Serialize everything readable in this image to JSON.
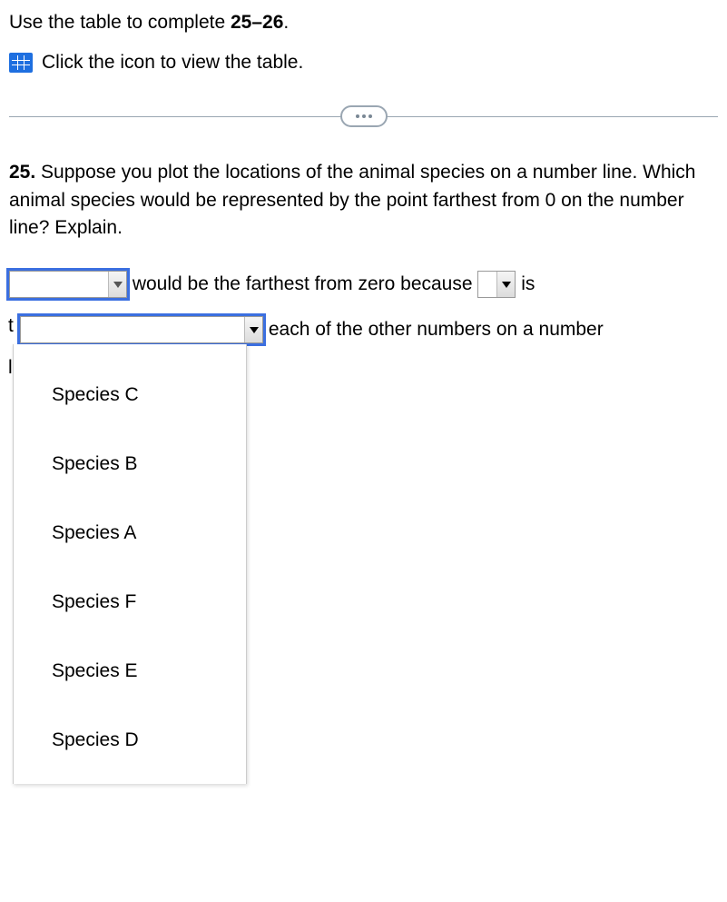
{
  "intro": {
    "prefix": "Use the table to complete ",
    "bold": "25–26",
    "suffix": "."
  },
  "icon_line": "Click the icon to view the table.",
  "question": {
    "number": "25.",
    "text": " Suppose you plot the locations of the animal species on a number line. Which animal species would be represented by the point farthest from 0 on the number line? Explain."
  },
  "answer": {
    "part1": " would be the farthest from zero because ",
    "part2_tail": " is",
    "part3_tail": " each of the other numbers on a number"
  },
  "left_chars": {
    "c1": "t",
    "c2": "l"
  },
  "dropdown1": {
    "value": "",
    "options": [
      "Species C",
      "Species B",
      "Species A",
      "Species F",
      "Species E",
      "Species D"
    ]
  },
  "dropdown2": {
    "value": ""
  },
  "dropdown3": {
    "value": ""
  }
}
